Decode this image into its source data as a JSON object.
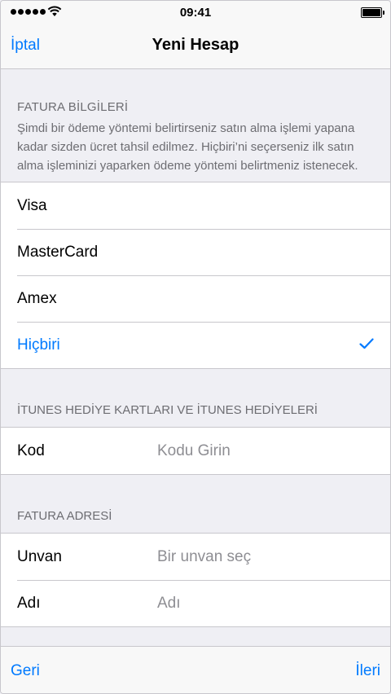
{
  "status_bar": {
    "time": "09:41"
  },
  "nav": {
    "cancel_label": "İptal",
    "title": "Yeni Hesap"
  },
  "billing_info": {
    "header": "FATURA BİLGİLERİ",
    "note": "Şimdi bir ödeme yöntemi belirtirseniz satın alma işlemi yapana kadar sizden ücret tahsil edilmez. Hiçbiri’ni seçerseniz ilk satın alma işleminizi yaparken ödeme yöntemi belirtmeniz istenecek.",
    "options": [
      {
        "label": "Visa",
        "selected": false
      },
      {
        "label": "MasterCard",
        "selected": false
      },
      {
        "label": "Amex",
        "selected": false
      },
      {
        "label": "Hiçbiri",
        "selected": true
      }
    ]
  },
  "gift_cards": {
    "header": "İTUNES HEDİYE KARTLARI VE İTUNES HEDİYELERİ",
    "code_label": "Kod",
    "code_placeholder": "Kodu Girin"
  },
  "billing_address": {
    "header": "FATURA ADRESİ",
    "title_label": "Unvan",
    "title_placeholder": "Bir unvan seç",
    "name_label": "Adı",
    "name_placeholder": "Adı"
  },
  "toolbar": {
    "back_label": "Geri",
    "next_label": "İleri"
  },
  "colors": {
    "accent": "#007aff",
    "background": "#efeff4",
    "separator": "#c8c7cc"
  }
}
